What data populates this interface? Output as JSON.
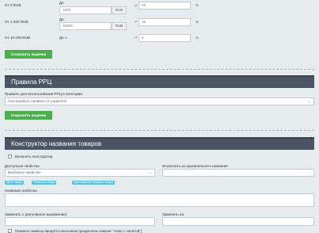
{
  "ranges": [
    {
      "from": "От 0 RUB",
      "to_label": "До",
      "to_value": "1000",
      "currency": "RUB",
      "markup": "25",
      "percent": "%"
    },
    {
      "from": "От 1 000 RUB",
      "to_label": "До",
      "to_value": "10000",
      "currency": "RUB",
      "markup": "15",
      "percent": "%"
    },
    {
      "from": "От 10 000 RUB",
      "to_label": "До ∞",
      "markup": "5",
      "percent": "%"
    }
  ],
  "save_markup_label": "Сохранить наценки",
  "rrp": {
    "heading": "Правила РРЦ",
    "category_rule_label": "Правило для использования РРЦ в категории",
    "category_rule_value": "Наследовать правило от родителя",
    "save_label": "Сохранить наценки"
  },
  "constructor": {
    "heading": "Конструктор названия товаров",
    "enable_label": "Включить конструктор",
    "available_props_label": "Доступные свойства",
    "available_props_placeholder": "Выберите свойство",
    "exclude_label": "Исключить из оригинального названия",
    "tags": [
      "Цена товара",
      "Portmonet товара",
      "Оригинальное название товара"
    ],
    "template_label": "Название шаблона",
    "replace_label": "Заменить с (регулярное выражение)",
    "replace_with_label": "Заменить на",
    "mass_rule_label": "Правила замены вводятся массивом (разделены знаком \"точка с запятой\")"
  }
}
